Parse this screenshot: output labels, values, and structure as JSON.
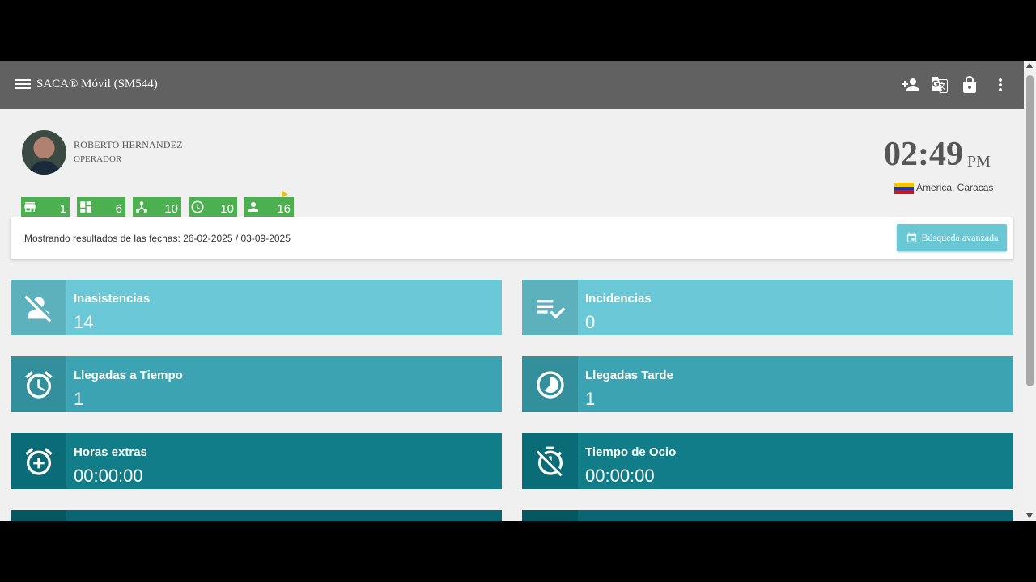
{
  "header": {
    "title": "SACA® Móvil (SM544)",
    "icons": [
      "menu-icon",
      "person-add-icon",
      "translate-icon",
      "lock-icon",
      "more-vert-icon"
    ]
  },
  "profile": {
    "name": "ROBERTO HERNANDEZ",
    "role": "OPERADOR"
  },
  "clock": {
    "time": "02:49",
    "ampm": "PM",
    "timezone": "America, Caracas"
  },
  "badges": [
    {
      "icon": "store-icon",
      "count": "1"
    },
    {
      "icon": "dashboard-icon",
      "count": "6"
    },
    {
      "icon": "hierarchy-icon",
      "count": "10"
    },
    {
      "icon": "clock-icon",
      "count": "10"
    },
    {
      "icon": "person-icon",
      "count": "16"
    }
  ],
  "filter": {
    "text": "Mostrando resultados de las fechas: 26-02-2025 / 03-09-2025",
    "button": "Búsqueda avanzada"
  },
  "cards": [
    {
      "label": "Inasistencias",
      "value": "14",
      "icon": "person-off-icon"
    },
    {
      "label": "Incidencias",
      "value": "0",
      "icon": "playlist-check-icon"
    },
    {
      "label": "Llegadas a Tiempo",
      "value": "1",
      "icon": "alarm-icon"
    },
    {
      "label": "Llegadas Tarde",
      "value": "1",
      "icon": "timelapse-icon"
    },
    {
      "label": "Horas extras",
      "value": "00:00:00",
      "icon": "alarm-add-icon"
    },
    {
      "label": "Tiempo de Ocio",
      "value": "00:00:00",
      "icon": "timer-off-icon"
    }
  ],
  "colors": {
    "header": "#616161",
    "badge": "#4caf50",
    "card_light": "#6bc9d7",
    "card_mid": "#3ba3b1",
    "card_dark": "#107d88",
    "button": "#6ac7d4"
  }
}
